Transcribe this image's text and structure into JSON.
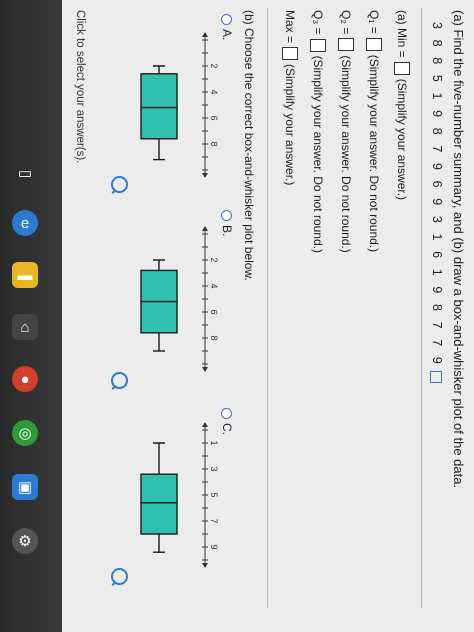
{
  "question": {
    "title": "(a) Find the five-number summary, and (b) draw a box-and-whisker plot of the data.",
    "data": "3 8 8 5 1 9 8 7 9 6 9 3 1 6 1 9 8 7 7 9"
  },
  "part_a": {
    "min_label": "(a) Min =",
    "min_hint": "(Simplify your answer.)",
    "q1_label": "Q₁ =",
    "q1_hint": "(Simplify your answer. Do not round.)",
    "q2_label": "Q₂ =",
    "q2_hint": "(Simplify your answer. Do not round.)",
    "q3_label": "Q₃ =",
    "q3_hint": "(Simplify your answer. Do not round.)",
    "max_label": "Max =",
    "max_hint": "(Simplify your answer.)"
  },
  "part_b": {
    "prompt": "(b) Choose the correct box-and-whisker plot below.",
    "options": [
      {
        "label": "A.",
        "min": 2,
        "q1": 2.6,
        "median": 5.2,
        "q3": 7.6,
        "max": 9.2,
        "ticks": [
          "2",
          "4",
          "6",
          "8"
        ]
      },
      {
        "label": "B.",
        "min": 2,
        "q1": 2.8,
        "median": 5.2,
        "q3": 7.6,
        "max": 9,
        "ticks": [
          "2",
          "4",
          "6",
          "8"
        ]
      },
      {
        "label": "C.",
        "min": 1,
        "q1": 3.4,
        "median": 5.6,
        "q3": 8,
        "max": 9.4,
        "ticks": [
          "1",
          "3",
          "5",
          "7",
          "9"
        ]
      }
    ]
  },
  "footer": "Click to select your answer(s).",
  "colors": {
    "box_fill": "#2fc0b2",
    "box_stroke": "#1a1a1a",
    "link_blue": "#2b7bd2"
  }
}
